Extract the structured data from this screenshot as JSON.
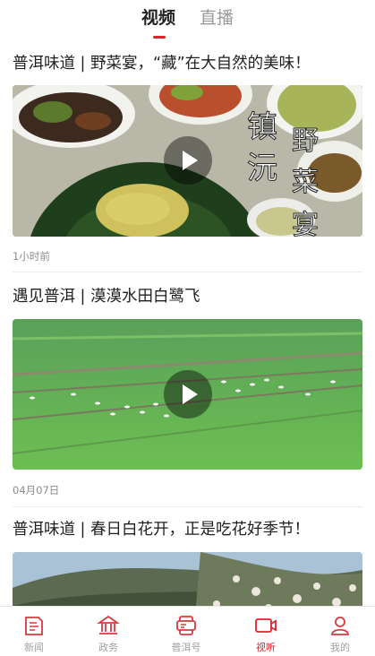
{
  "header": {
    "tabs": [
      {
        "label": "视频",
        "active": true
      },
      {
        "label": "直播",
        "active": false
      }
    ]
  },
  "feed": [
    {
      "title": "普洱味道 | 野菜宴，“藏”在大自然的美味！",
      "thumbnail_text": "镇沅野菜宴",
      "time": "1小时前"
    },
    {
      "title": "遇见普洱 | 漠漠水田白鹭飞",
      "time": "04月07日"
    },
    {
      "title": "普洱味道 | 春日白花开，正是吃花好季节！"
    }
  ],
  "bottom_nav": [
    {
      "label": "新闻",
      "icon": "news-icon",
      "active": false
    },
    {
      "label": "政务",
      "icon": "government-building-icon",
      "active": false
    },
    {
      "label": "普洱号",
      "icon": "account-cards-icon",
      "active": false
    },
    {
      "label": "视听",
      "icon": "video-camera-icon",
      "active": true
    },
    {
      "label": "我的",
      "icon": "user-icon",
      "active": false
    }
  ],
  "colors": {
    "accent": "#e0222b",
    "inactive": "#a0a0a0"
  }
}
